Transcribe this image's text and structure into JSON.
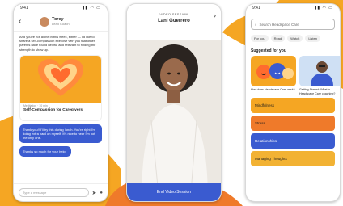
{
  "colors": {
    "brand_orange": "#f5a623",
    "brand_blue": "#3a5bd0"
  },
  "chat": {
    "status_time": "9:41",
    "status_icons": "signal-wifi-battery",
    "coach_name": "Torey",
    "coach_role": "Lead Coach",
    "message": "And you're not alone in this week, either — I'd like to share a self-compassion exercise with you that other parents have found helpful and relevant to finding the strength to show up.",
    "card_meta": "Meditation · 10 min",
    "card_title": "Self-Compassion for Caregivers",
    "reply_1": "Thank you!! I'll try this during lunch. You're right I'm doing extra hard on myself. It's nice to hear I'm not the only one.",
    "reply_2": "Thanks so much for your help",
    "input_placeholder": "Type a message"
  },
  "video": {
    "status_time": "9:41",
    "session_label": "VIDEO SESSION",
    "coach_name": "Lani Guerrero",
    "end_label": "End Video Session"
  },
  "browse": {
    "status_time": "9:41",
    "search_placeholder": "Search Headspace Care",
    "chips": [
      "For you",
      "Read",
      "Watch",
      "Listen"
    ],
    "section_title": "Suggested for you",
    "tile_1": "How does Headspace Care work?",
    "tile_2": "Getting Started: What is Headspace Care coaching?",
    "categories": [
      "Mindfulness",
      "Stress",
      "Relationships",
      "Managing Thoughts"
    ]
  }
}
